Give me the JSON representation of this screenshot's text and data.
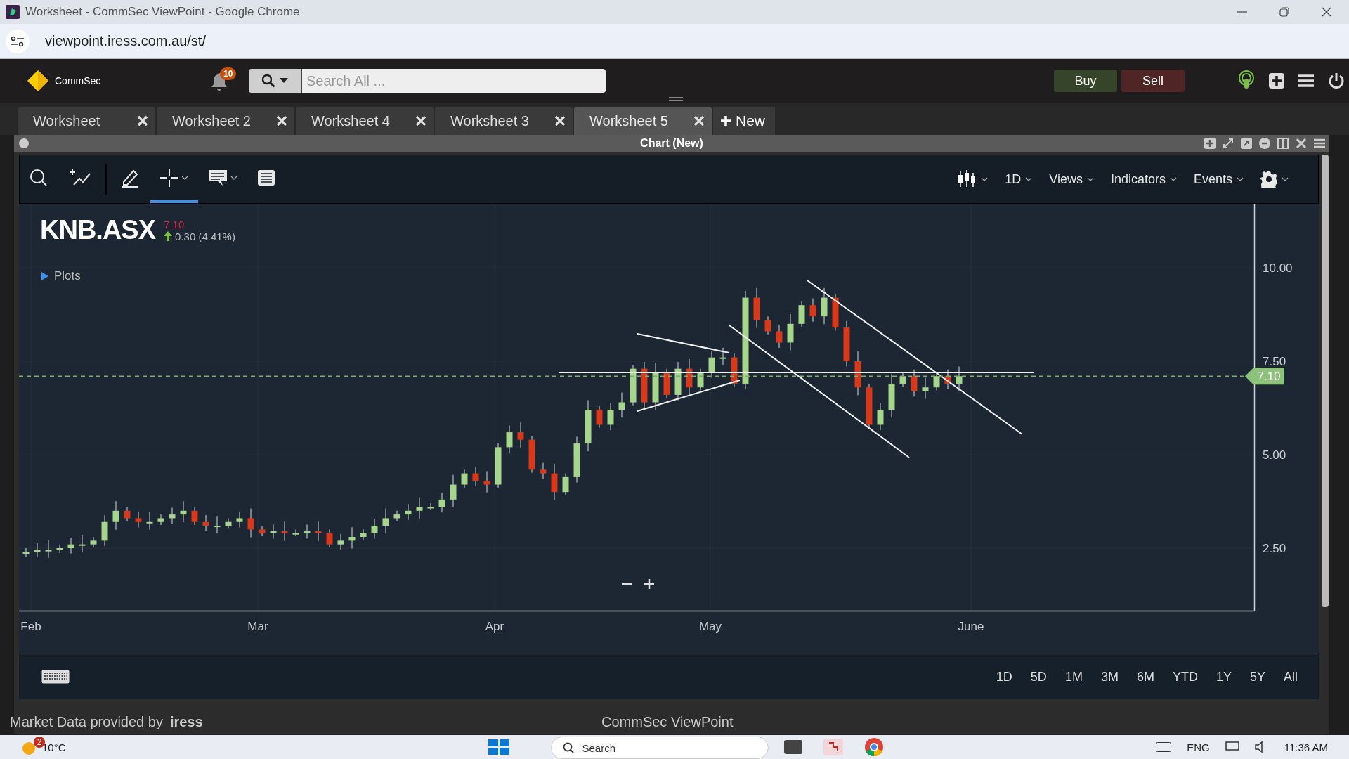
{
  "browser": {
    "title": "Worksheet - CommSec ViewPoint - Google Chrome",
    "url": "viewpoint.iress.com.au/st/"
  },
  "header": {
    "brand": "CommSec",
    "notification_count": "10",
    "search": {
      "placeholder": "Search All ..."
    },
    "buttons": [
      {
        "label": "Buy",
        "kind": "buy"
      },
      {
        "label": "Sell",
        "kind": "sell"
      }
    ]
  },
  "tabs": [
    {
      "label": "Worksheet",
      "selected": false
    },
    {
      "label": "Worksheet 2",
      "selected": false
    },
    {
      "label": "Worksheet 4",
      "selected": false
    },
    {
      "label": "Worksheet 3",
      "selected": false
    },
    {
      "label": "Worksheet 5",
      "selected": true
    }
  ],
  "new_tab": "New",
  "panel": {
    "title": "Chart (New)"
  },
  "toolbar": {
    "tools": [
      {
        "kind": "search",
        "selected": false,
        "menu": false
      },
      {
        "kind": "indicator",
        "selected": false,
        "menu": false
      },
      {
        "kind": "pencil",
        "selected": false,
        "menu": false
      },
      {
        "kind": "crosshair",
        "selected": true,
        "menu": true
      },
      {
        "kind": "comment",
        "selected": false,
        "menu": true
      },
      {
        "kind": "table",
        "selected": false,
        "menu": false
      }
    ],
    "menus": [
      {
        "kind": "candles"
      },
      {
        "kind": "text",
        "label": "1D"
      },
      {
        "kind": "text",
        "label": "Views"
      },
      {
        "kind": "text",
        "label": "Indicators"
      },
      {
        "kind": "text",
        "label": "Events"
      },
      {
        "kind": "gear"
      }
    ]
  },
  "chart": {
    "symbol": "KNB.ASX",
    "last": "7.10",
    "change": "0.30 (4.41%)",
    "plots": "Plots",
    "y_labels": [
      "10.00",
      "7.50",
      "5.00",
      "2.50"
    ],
    "x_labels": [
      "Feb",
      "Mar",
      "Apr",
      "May",
      "June"
    ],
    "price_tag": "7.10"
  },
  "ranges": [
    "1D",
    "5D",
    "1M",
    "3M",
    "6M",
    "YTD",
    "1Y",
    "5Y",
    "All"
  ],
  "footer": {
    "note": "Market Data provided by",
    "brand": "iress",
    "ghost_title": "CommSec ViewPoint"
  },
  "taskbar": {
    "weather_badge": "2",
    "temperature": "10°C",
    "search": "Search",
    "language": "ENG",
    "time": "11:36 AM"
  }
}
